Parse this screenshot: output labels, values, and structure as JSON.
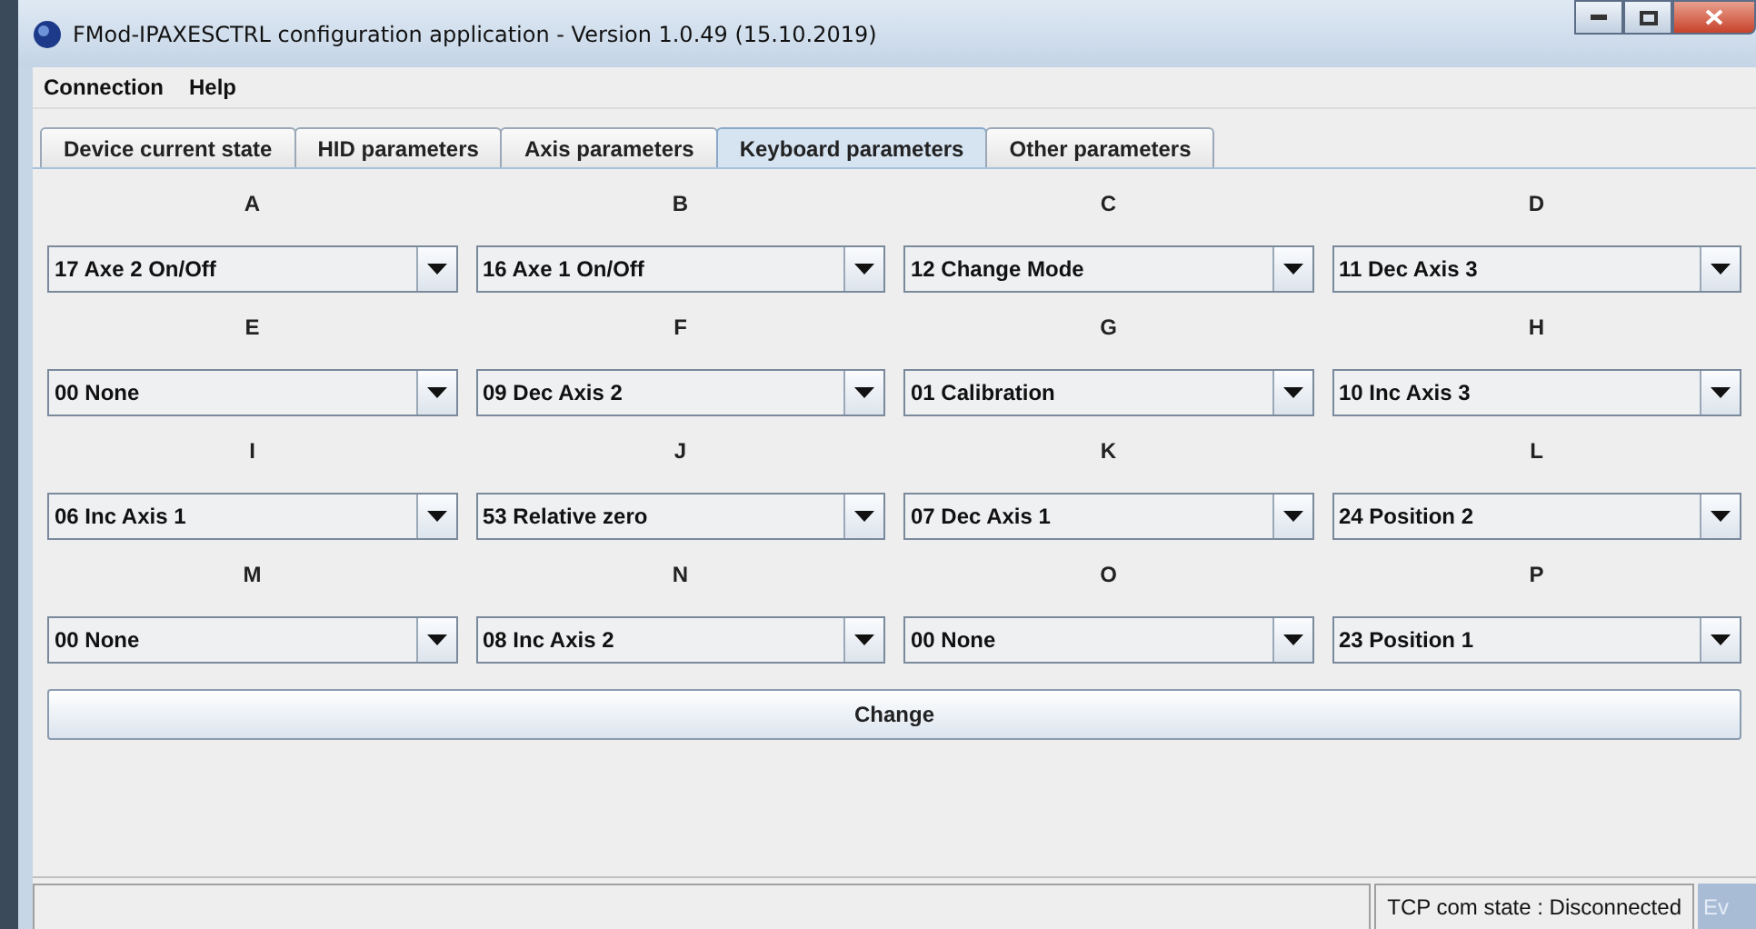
{
  "window": {
    "title": "FMod-IPAXESCTRL configuration application - Version 1.0.49 (15.10.2019)"
  },
  "menu": [
    "Connection",
    "Help"
  ],
  "tabs": [
    {
      "label": "Device current state",
      "selected": false
    },
    {
      "label": "HID parameters",
      "selected": false
    },
    {
      "label": "Axis parameters",
      "selected": false
    },
    {
      "label": "Keyboard parameters",
      "selected": true
    },
    {
      "label": "Other parameters",
      "selected": false
    }
  ],
  "keys": [
    {
      "label": "A",
      "value": "17 Axe 2 On/Off"
    },
    {
      "label": "B",
      "value": "16 Axe 1 On/Off"
    },
    {
      "label": "C",
      "value": "12 Change Mode"
    },
    {
      "label": "D",
      "value": "11 Dec Axis 3"
    },
    {
      "label": "E",
      "value": "00 None"
    },
    {
      "label": "F",
      "value": "09 Dec Axis 2"
    },
    {
      "label": "G",
      "value": "01 Calibration"
    },
    {
      "label": "H",
      "value": "10 Inc Axis 3"
    },
    {
      "label": "I",
      "value": "06 Inc Axis 1"
    },
    {
      "label": "J",
      "value": "53 Relative zero"
    },
    {
      "label": "K",
      "value": "07 Dec Axis 1"
    },
    {
      "label": "L",
      "value": "24 Position 2"
    },
    {
      "label": "M",
      "value": "00 None"
    },
    {
      "label": "N",
      "value": "08 Inc Axis 2"
    },
    {
      "label": "O",
      "value": "00 None"
    },
    {
      "label": "P",
      "value": "23 Position 1"
    }
  ],
  "button": "Change",
  "status_bar": {
    "connection": "TCP com state : Disconnected",
    "panel_2": "Ev"
  }
}
